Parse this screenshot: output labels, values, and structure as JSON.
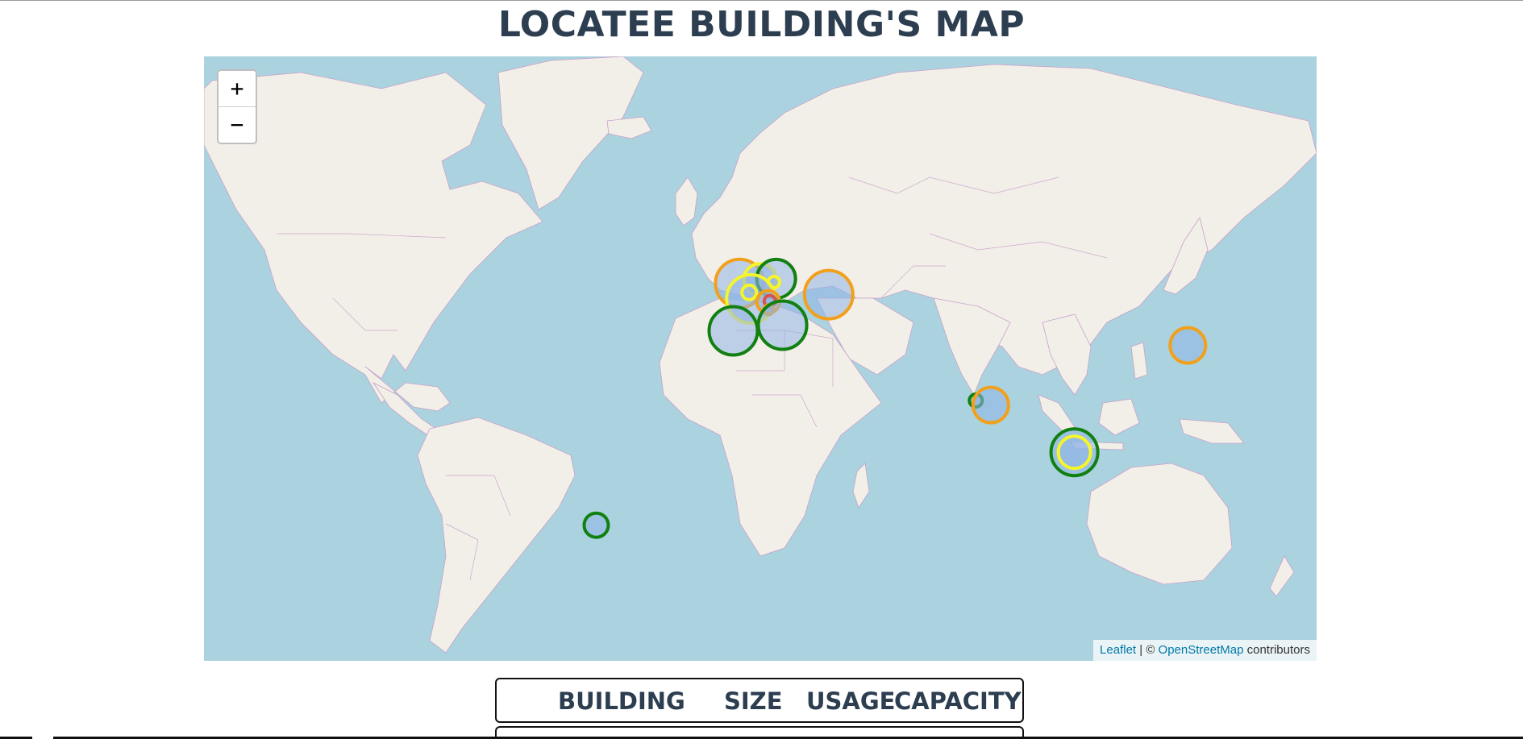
{
  "page": {
    "title": "LOCATEE BUILDING'S MAP"
  },
  "map": {
    "zoom_in_label": "+",
    "zoom_out_label": "−",
    "attribution": {
      "leaflet": "Leaflet",
      "separator": " | © ",
      "osm": "OpenStreetMap",
      "suffix": " contributors"
    },
    "colors": {
      "water": "#aad3df",
      "land": "#f2efe9",
      "border": "#c9a0c9",
      "marker_fill": "#8fb4e6",
      "green": "#118011",
      "orange": "#f2a01c",
      "yellow": "#f5f52a",
      "red": "#d9534f"
    },
    "markers": [
      {
        "name": "marker-uk",
        "lat": 51.5,
        "lon": -1.5,
        "color": "orange"
      },
      {
        "name": "marker-netherlands",
        "lat": 52.3,
        "lon": 4.9,
        "color": "yellow"
      },
      {
        "name": "marker-germany-north",
        "lat": 52.5,
        "lon": 10.0,
        "color": "green"
      },
      {
        "name": "marker-germany-small",
        "lat": 51.8,
        "lon": 9.3,
        "color": "yellow"
      },
      {
        "name": "marker-france",
        "lat": 48.0,
        "lon": 2.0,
        "color": "yellow"
      },
      {
        "name": "marker-paris",
        "lat": 49.5,
        "lon": 1.5,
        "color": "yellow"
      },
      {
        "name": "marker-switzerland",
        "lat": 47.3,
        "lon": 7.5,
        "color": "orange"
      },
      {
        "name": "marker-zurich",
        "lat": 47.5,
        "lon": 8.0,
        "color": "red"
      },
      {
        "name": "marker-lyon",
        "lat": 45.4,
        "lon": 7.6,
        "color": "orange"
      },
      {
        "name": "marker-spain",
        "lat": 40.0,
        "lon": -3.5,
        "color": "green"
      },
      {
        "name": "marker-italy",
        "lat": 41.5,
        "lon": 12.0,
        "color": "green"
      },
      {
        "name": "marker-ukraine",
        "lat": 49.0,
        "lon": 26.5,
        "color": "orange"
      },
      {
        "name": "marker-mumbai",
        "lat": 19.0,
        "lon": 72.8,
        "color": "green"
      },
      {
        "name": "marker-india",
        "lat": 17.5,
        "lon": 77.5,
        "color": "orange"
      },
      {
        "name": "marker-singapore",
        "lat": 1.3,
        "lon": 103.8,
        "color": "green"
      },
      {
        "name": "marker-singapore-inner",
        "lat": 1.3,
        "lon": 103.8,
        "color": "yellow"
      },
      {
        "name": "marker-japan",
        "lat": 36.0,
        "lon": 139.5,
        "color": "orange"
      },
      {
        "name": "marker-sao-paulo",
        "lat": -23.5,
        "lon": -46.6,
        "color": "green"
      }
    ]
  },
  "table": {
    "headers": {
      "building": "BUILDING",
      "size": "SIZE",
      "usage": "USAGE",
      "capacity": "CAPACITY"
    }
  }
}
